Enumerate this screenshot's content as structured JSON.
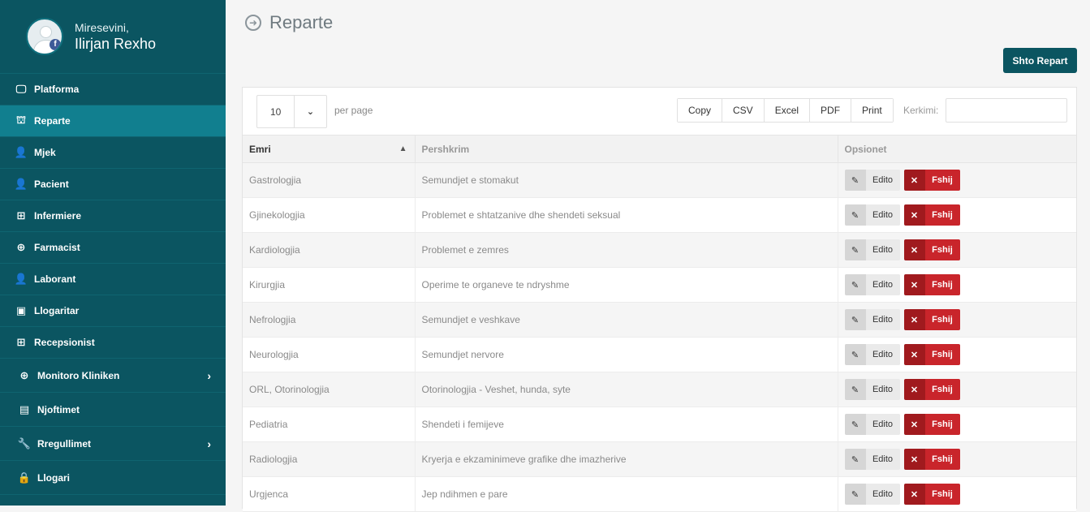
{
  "user": {
    "greeting": "Miresevini,",
    "name": "Ilirjan Rexho"
  },
  "sidebar": {
    "items": [
      {
        "label": "Platforma",
        "icon": "monitor-icon",
        "glyph": "🖵"
      },
      {
        "label": "Reparte",
        "icon": "sitemap-icon",
        "glyph": "⛫",
        "active": true
      },
      {
        "label": "Mjek",
        "icon": "user-md-icon",
        "glyph": "👤"
      },
      {
        "label": "Pacient",
        "icon": "user-icon",
        "glyph": "👤"
      },
      {
        "label": "Infermiere",
        "icon": "plus-square-icon",
        "glyph": "⊞"
      },
      {
        "label": "Farmacist",
        "icon": "medkit-icon",
        "glyph": "⊕"
      },
      {
        "label": "Laborant",
        "icon": "user-icon",
        "glyph": "👤"
      },
      {
        "label": "Llogaritar",
        "icon": "money-icon",
        "glyph": "▣"
      },
      {
        "label": "Recepsionist",
        "icon": "plus-square-icon",
        "glyph": "⊞"
      },
      {
        "label": "Monitoro Kliniken",
        "icon": "crosshair-icon",
        "glyph": "⊕",
        "chevron": true
      },
      {
        "label": "Njoftimet",
        "icon": "document-icon",
        "glyph": "▤"
      },
      {
        "label": "Rregullimet",
        "icon": "wrench-icon",
        "glyph": "🔧",
        "chevron": true
      },
      {
        "label": "Llogari",
        "icon": "lock-icon",
        "glyph": "🔒"
      }
    ]
  },
  "page": {
    "title": "Reparte",
    "add_button": "Shto Repart"
  },
  "toolbar": {
    "page_size": "10",
    "per_page_label": "per page",
    "export_buttons": [
      "Copy",
      "CSV",
      "Excel",
      "PDF",
      "Print"
    ],
    "search_label": "Kerkimi:",
    "search_value": ""
  },
  "table": {
    "headers": [
      "Emri",
      "Pershkrim",
      "Opsionet"
    ],
    "edit_label": "Edito",
    "delete_label": "Fshij",
    "rows": [
      {
        "name": "Gastrologjia",
        "description": "Semundjet e stomakut"
      },
      {
        "name": "Gjinekologjia",
        "description": "Problemet e shtatzanive dhe shendeti seksual"
      },
      {
        "name": "Kardiologjia",
        "description": "Problemet e zemres"
      },
      {
        "name": "Kirurgjia",
        "description": "Operime te organeve te ndryshme"
      },
      {
        "name": "Nefrologjia",
        "description": "Semundjet e veshkave"
      },
      {
        "name": "Neurologjia",
        "description": "Semundjet nervore"
      },
      {
        "name": "ORL, Otorinologjia",
        "description": "Otorinologjia - Veshet, hunda, syte"
      },
      {
        "name": "Pediatria",
        "description": "Shendeti i femijeve"
      },
      {
        "name": "Radiologjia",
        "description": "Kryerja e ekzaminimeve grafike dhe imazherive"
      },
      {
        "name": "Urgjenca",
        "description": "Jep ndihmen e pare"
      }
    ]
  },
  "colors": {
    "sidebar": "#0b5561",
    "active": "#117f8f",
    "danger": "#c9252b"
  }
}
